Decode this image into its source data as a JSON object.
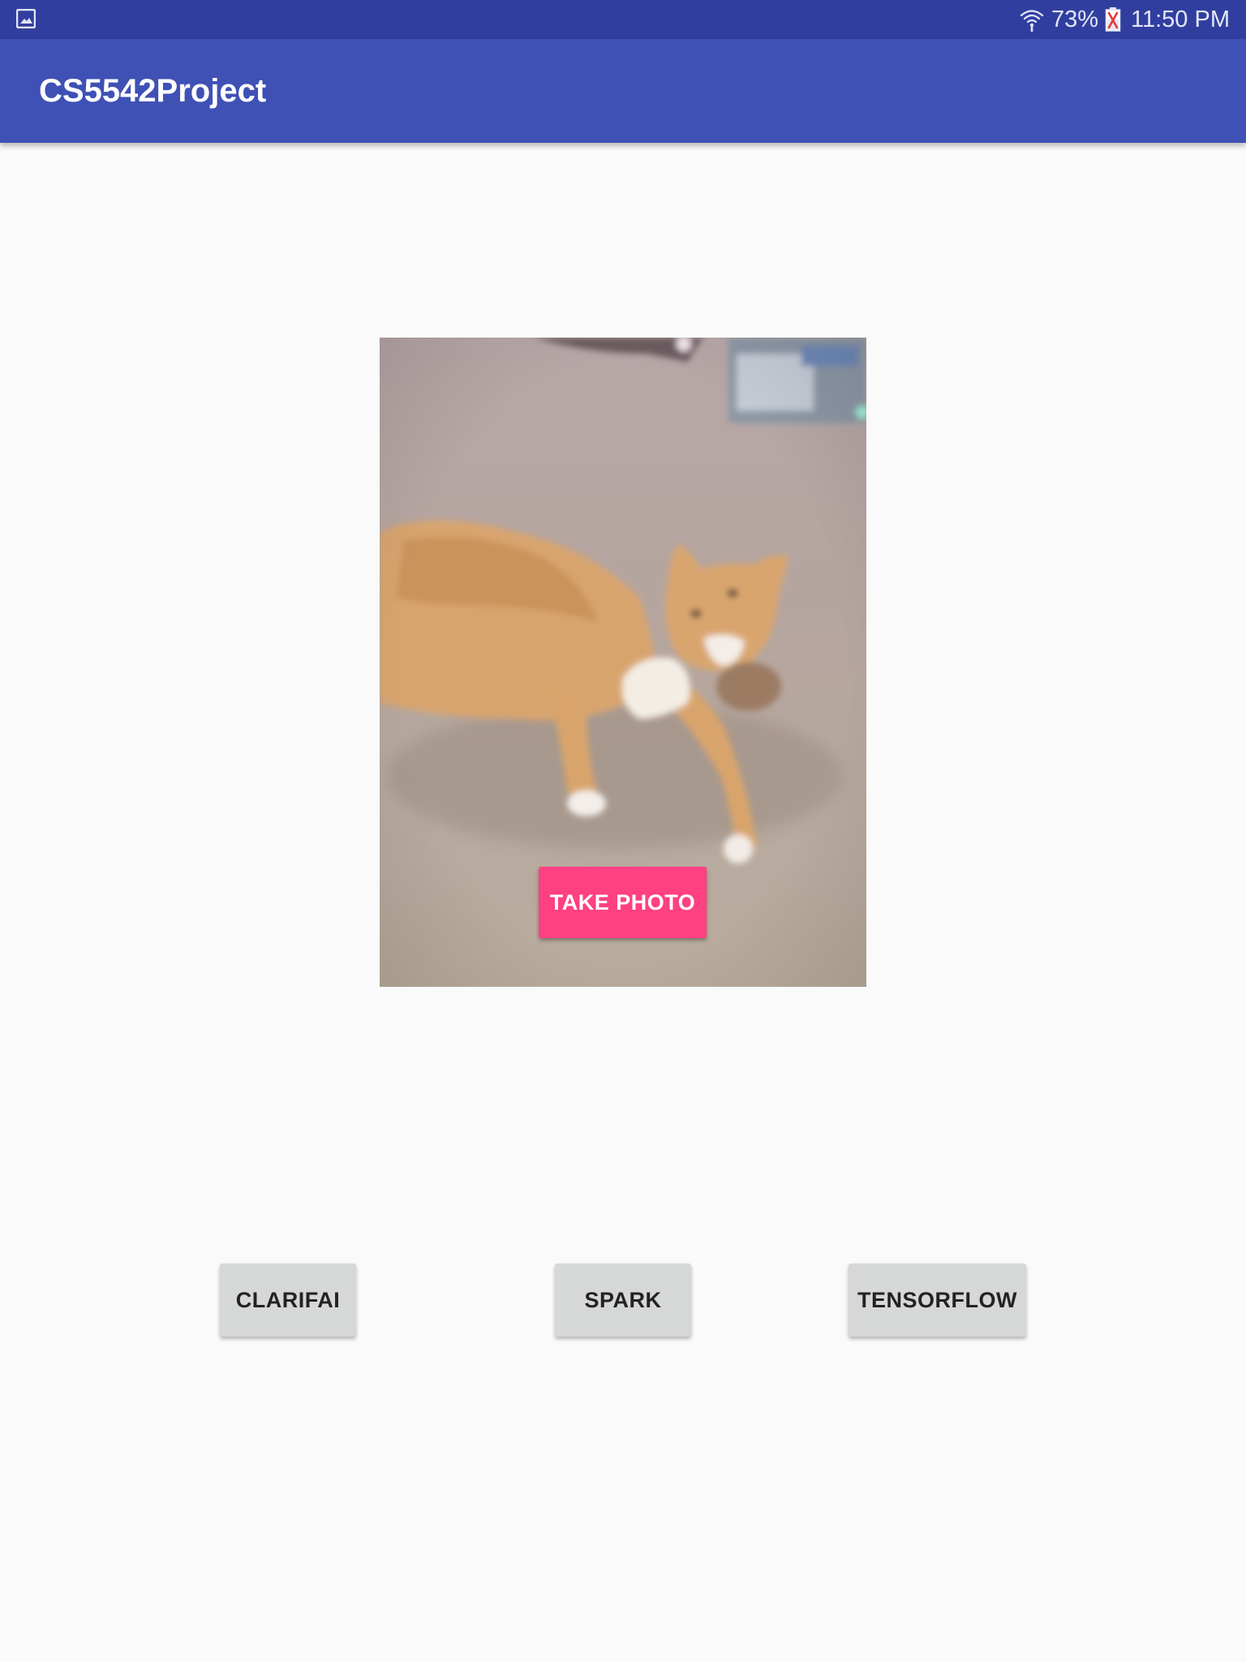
{
  "status_bar": {
    "left_icon": "gallery-notification-icon",
    "wifi_icon": "wifi-icon",
    "battery_percent": "73%",
    "battery_icon": "battery-icon",
    "time": "11:50 PM",
    "background_color": "#303F9F"
  },
  "app_bar": {
    "title": "CS5542Project",
    "background_color": "#3F51B5"
  },
  "photo": {
    "subject": "orange tabby cat lying on carpet",
    "take_photo_label": "TAKE PHOTO",
    "take_photo_color": "#FF4081"
  },
  "actions": {
    "clarifai_label": "CLARIFAI",
    "spark_label": "SPARK",
    "tensorflow_label": "TENSORFLOW"
  }
}
